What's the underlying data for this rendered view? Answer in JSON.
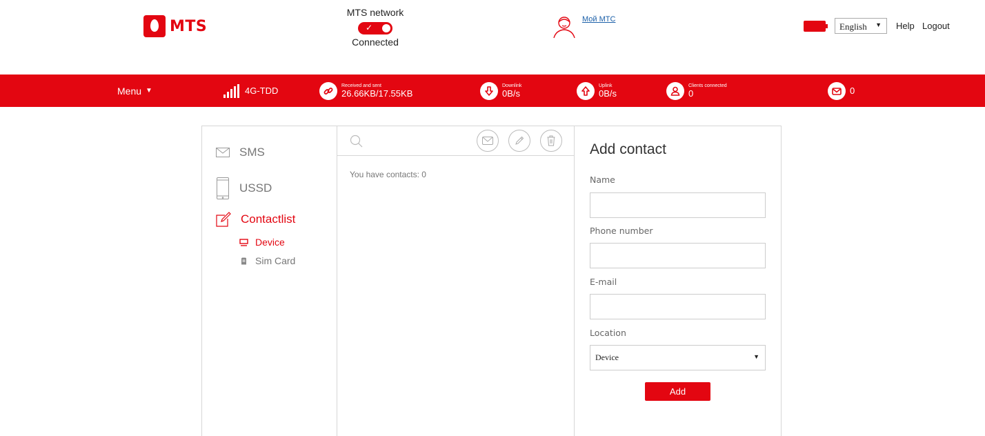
{
  "brand": {
    "logo_text": "MTS",
    "color": "#e30611"
  },
  "header": {
    "network_label": "MTS network",
    "network_status": "Connected",
    "my_mts_link": "Мой МТС",
    "language": "English",
    "help": "Help",
    "logout": "Logout"
  },
  "statusbar": {
    "menu": "Menu",
    "network_type": "4G-TDD",
    "received_sent_label": "Received and sent",
    "received_sent_value": "26.66KB/17.55KB",
    "downlink_label": "Downlink",
    "downlink_value": "0B/s",
    "uplink_label": "Uplink",
    "uplink_value": "0B/s",
    "clients_label": "Clients connected",
    "clients_value": "0",
    "messages_value": "0"
  },
  "sidebar": {
    "items": [
      {
        "label": "SMS",
        "icon": "envelope-icon"
      },
      {
        "label": "USSD",
        "icon": "phone-icon"
      },
      {
        "label": "Contactlist",
        "icon": "edit-icon",
        "active": true
      }
    ],
    "subitems": [
      {
        "label": "Device",
        "icon": "monitor-icon",
        "active": true
      },
      {
        "label": "Sim Card",
        "icon": "sim-card-icon"
      }
    ]
  },
  "contacts": {
    "count_text": "You have contacts: 0"
  },
  "form": {
    "title": "Add contact",
    "name_label": "Name",
    "name_value": "",
    "phone_label": "Phone number",
    "phone_value": "",
    "email_label": "E-mail",
    "email_value": "",
    "location_label": "Location",
    "location_value": "Device",
    "add_button": "Add"
  }
}
